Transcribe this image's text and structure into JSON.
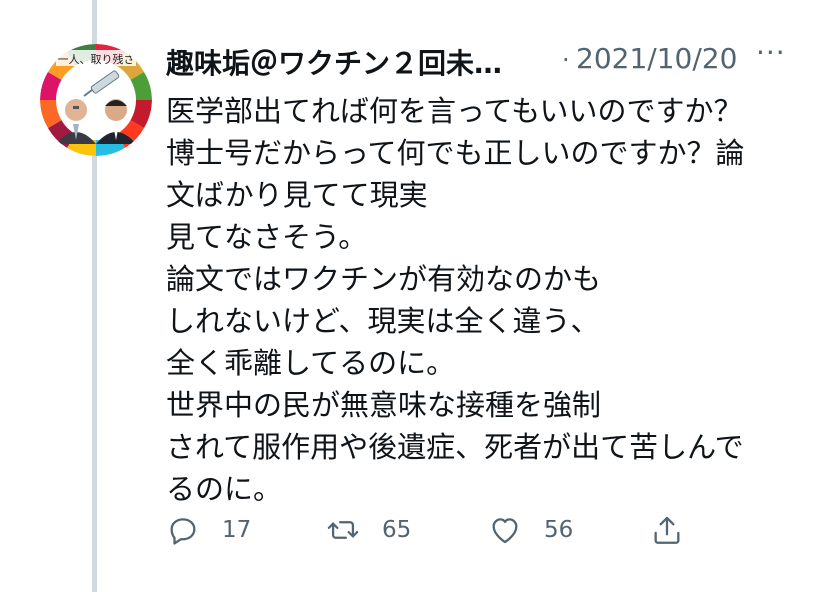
{
  "tweet": {
    "display_name": "趣味垢＠ワクチン２回未…",
    "separator": "·",
    "date": "2021/10/20",
    "more_label": "···",
    "text_lines": [
      "医学部出てれば何を言ってもいいのですか？",
      "博士号だからって何でも正しいのですか？論",
      "文ばかり見てて現実",
      "見てなさそう。",
      "論文ではワクチンが有効なのかも",
      "しれないけど、現実は全く違う、",
      "全く乖離してるのに。",
      "世界中の民が無意味な接種を強制",
      "されて服作用や後遺症、死者が出て苦しんで",
      "るのに。"
    ]
  },
  "avatar": {
    "banner_text": "一人、取り残さ"
  },
  "actions": {
    "reply": {
      "icon": "reply-icon",
      "count": "17"
    },
    "retweet": {
      "icon": "retweet-icon",
      "count": "65"
    },
    "like": {
      "icon": "heart-icon",
      "count": "56"
    },
    "share": {
      "icon": "share-icon"
    }
  },
  "colors": {
    "text": "#0f1419",
    "secondary": "#536471",
    "thread_line": "#cfd9de"
  }
}
